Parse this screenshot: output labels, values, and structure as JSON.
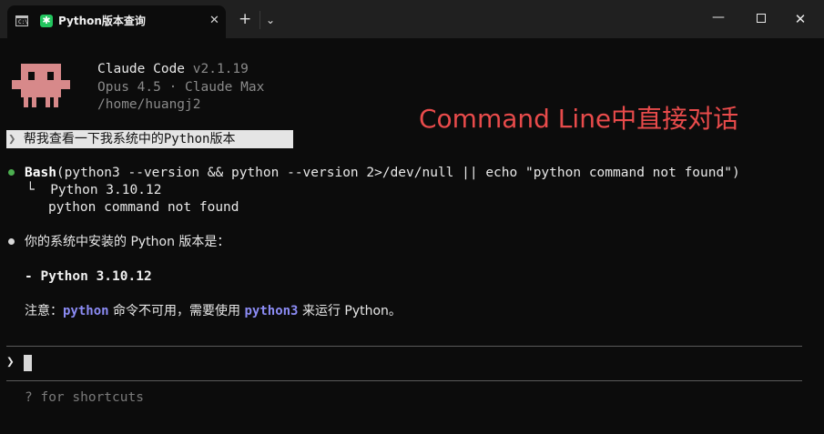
{
  "window": {
    "tab_title": "Python版本查询",
    "tab_close": "✕",
    "new_tab": "+",
    "dropdown": "⌄",
    "terminal_icon_text": "C:\\",
    "app_icon_glyph": "✱",
    "minimize": "—",
    "close": "✕"
  },
  "header": {
    "app_name": "Claude Code",
    "version": "v2.1.19",
    "model_line": "Opus 4.5 · Claude Max",
    "cwd": "/home/huangj2",
    "mascot_color": "#d7898a"
  },
  "annotation": {
    "text": "Command Line中直接对话",
    "color": "#e84b4b"
  },
  "conversation": {
    "user_prompt_chevron": "❯",
    "user_prompt": "帮我查看一下我系统中的Python版本",
    "tool_call": {
      "tool": "Bash",
      "args": "(python3 --version && python --version 2>/dev/null || echo \"python command not found\")",
      "status_color": "#4caf50"
    },
    "tool_output": {
      "prefix": "└",
      "line1": "Python 3.10.12",
      "line2": "python command not found"
    },
    "response": {
      "line1": "你的系统中安装的 Python 版本是：",
      "line2": "- Python 3.10.12",
      "line3_a": "注意：",
      "line3_code1": "python",
      "line3_b": " 命令不可用，需要使用 ",
      "line3_code2": "python3",
      "line3_c": " 来运行 Python。",
      "code_color": "#8c8cf5"
    }
  },
  "input": {
    "chevron": "❯",
    "value": ""
  },
  "footer": {
    "hint": "? for shortcuts"
  }
}
